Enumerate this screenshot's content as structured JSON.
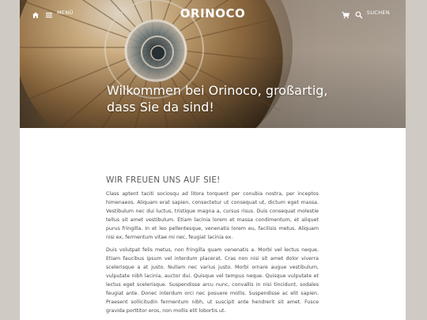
{
  "header": {
    "menu_label": "MENÜ",
    "brand": "ORINOCO",
    "search_label": "SUCHEN",
    "icons": {
      "home": "home-icon",
      "menu": "hamburger-icon",
      "cart": "cart-icon",
      "search": "search-icon"
    }
  },
  "hero": {
    "title": "Wilkommen bei Orinoco, großartig, dass Sie da sind!"
  },
  "main": {
    "heading": "WIR FREUEN UNS AUF SIE!",
    "paragraphs": [
      "Class aptent taciti sociosqu ad litora torquent per conubia nostra, per inceptos himenaeos. Aliquam erat sapien, consectetur ut consequat ut, dictum eget massa. Vestibulum nec dui luctus, tristique magna a, cursus risus. Duis consequat molestie tellus sit amet vestibulum. Etiam lacinia lorem et massa condimentum, et aliquet purus fringilla. In et leo pellentesque, venenatis lorem eu, facilisis metus. Aliquam nisi ex, fermentum vitae mi nec, feugiat lacinia ex.",
      "Duis volutpat felis metus, non fringilla quam venenatis a. Morbi vel lectus neque. Etiam faucibus ipsum vel interdum placerat. Cras non nisi sit amet dolor viverra scelerisque a at justo. Nullam nec varius justo. Morbi ornare augue vestibulum, vulputate nibh lacinia, auctor dui. Quisque vel tempus neque. Quisque vulputate et lectus eget scelerisque. Suspendisse arcu nunc, convallis in nisi tincidunt, sodales feugiat ante. Donec interdum orci nec posuere mollis. Suspendisse ac elit sapien. Praesent sollicitudin fermentum nibh, ut suscipit ante hendrerit sit amet. Fusce gravida porttitor eros, non mollis elit lobortis ut."
    ]
  },
  "colors": {
    "page_bg": "#cfcac3",
    "content_bg": "#ffffff",
    "heading": "#5b5b5b",
    "text": "#4a4a4a"
  }
}
